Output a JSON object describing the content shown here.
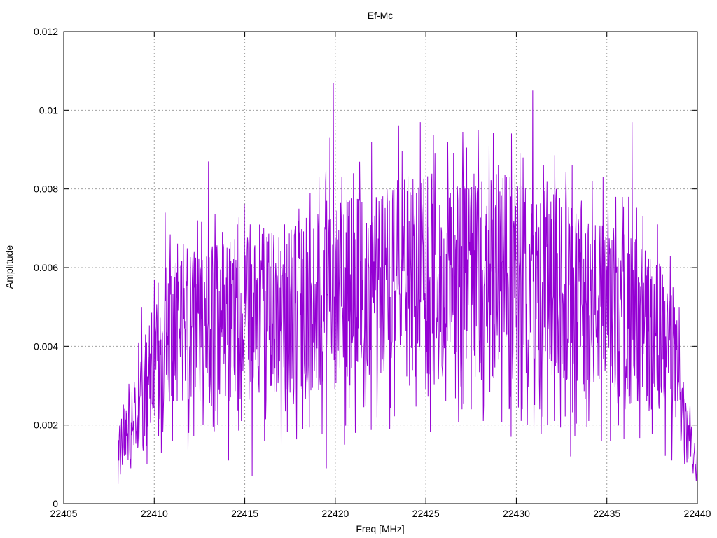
{
  "chart_data": {
    "type": "line",
    "title": "Ef-Mc",
    "xlabel": "Freq [MHz]",
    "ylabel": "Amplitude",
    "xlim": [
      22405,
      22440
    ],
    "ylim": [
      0,
      0.012
    ],
    "xticks": [
      22405,
      22410,
      22415,
      22420,
      22425,
      22430,
      22435,
      22440
    ],
    "xtick_labels": [
      "22405",
      "22410",
      "22415",
      "22420",
      "22425",
      "22430",
      "22435",
      "22440"
    ],
    "yticks": [
      0,
      0.002,
      0.004,
      0.006,
      0.008,
      0.01,
      0.012
    ],
    "ytick_labels": [
      "0",
      "0.002",
      "0.004",
      "0.006",
      "0.008",
      "0.01",
      "0.012"
    ],
    "grid": true,
    "series": [
      {
        "color": "#9400d3",
        "envelope": {
          "x": [
            22408.0,
            22408.5,
            22409.0,
            22409.5,
            22410.0,
            22410.5,
            22411.0,
            22412.0,
            22413.0,
            22414.0,
            22415.0,
            22416.0,
            22417.0,
            22418.0,
            22419.0,
            22420.0,
            22421.0,
            22422.0,
            22423.0,
            22424.0,
            22425.0,
            22426.0,
            22427.0,
            22428.0,
            22429.0,
            22430.0,
            22431.0,
            22432.0,
            22433.0,
            22434.0,
            22435.0,
            22436.0,
            22437.0,
            22438.0,
            22438.8,
            22439.2,
            22439.6,
            22440.0
          ],
          "y": [
            0.0013,
            0.0018,
            0.0024,
            0.003,
            0.0036,
            0.0041,
            0.0043,
            0.0044,
            0.0045,
            0.0046,
            0.0047,
            0.0048,
            0.0049,
            0.005,
            0.0052,
            0.0054,
            0.0055,
            0.0056,
            0.0057,
            0.0058,
            0.0058,
            0.0058,
            0.0058,
            0.0058,
            0.0058,
            0.0057,
            0.0056,
            0.0055,
            0.0053,
            0.0051,
            0.0049,
            0.0048,
            0.0046,
            0.0042,
            0.0035,
            0.0022,
            0.0015,
            0.0009
          ]
        },
        "peaks": {
          "x": [
            22408.0,
            22408.7,
            22409.3,
            22409.6,
            22410.0,
            22410.6,
            22411.0,
            22411.6,
            22412.4,
            22413.0,
            22413.8,
            22414.6,
            22415.3,
            22416.0,
            22417.2,
            22418.0,
            22418.6,
            22419.1,
            22419.7,
            22419.9,
            22420.5,
            22421.0,
            22422.0,
            22423.0,
            22423.5,
            22424.1,
            22424.7,
            22425.5,
            22426.2,
            22427.0,
            22427.9,
            22428.5,
            22429.0,
            22429.7,
            22430.2,
            22430.9,
            22431.5,
            22432.2,
            22433.0,
            22433.6,
            22434.2,
            22434.8,
            22435.5,
            22436.2,
            22436.4,
            22437.0,
            22437.8,
            22438.5,
            22439.0,
            22439.6,
            22440.0
          ],
          "y": [
            0.0005,
            0.0031,
            0.005,
            0.0054,
            0.0057,
            0.0074,
            0.0083,
            0.0066,
            0.0072,
            0.0087,
            0.0066,
            0.0071,
            0.0071,
            0.0066,
            0.0071,
            0.0075,
            0.0079,
            0.0083,
            0.0093,
            0.0107,
            0.0089,
            0.0084,
            0.0092,
            0.0087,
            0.0096,
            0.0087,
            0.0097,
            0.0089,
            0.0092,
            0.0091,
            0.0095,
            0.0091,
            0.0086,
            0.0092,
            0.0089,
            0.0105,
            0.0086,
            0.008,
            0.0082,
            0.0077,
            0.0082,
            0.0083,
            0.0078,
            0.0078,
            0.0097,
            0.0073,
            0.0071,
            0.0063,
            0.005,
            0.0025,
            0.0016
          ]
        },
        "troughs": {
          "x": [
            22408.0,
            22408.7,
            22409.6,
            22410.4,
            22411.0,
            22411.9,
            22412.7,
            22413.5,
            22414.1,
            22414.8,
            22415.4,
            22416.1,
            22417.0,
            22418.2,
            22419.5,
            22420.5,
            22421.1,
            22422.3,
            22423.0,
            22424.1,
            22425.0,
            22426.1,
            22427.0,
            22428.2,
            22429.7,
            22430.6,
            22431.3,
            22432.1,
            22433.0,
            22434.0,
            22434.7,
            22435.2,
            22436.0,
            22437.2,
            22438.6,
            22439.3,
            22440.0
          ],
          "y": [
            0.0005,
            0.0009,
            0.001,
            0.0013,
            0.0016,
            0.0018,
            0.002,
            0.002,
            0.0011,
            0.0021,
            0.0007,
            0.0016,
            0.0015,
            0.0019,
            0.0009,
            0.0015,
            0.0018,
            0.0022,
            0.0019,
            0.003,
            0.0029,
            0.0026,
            0.0024,
            0.0025,
            0.0017,
            0.002,
            0.0024,
            0.0021,
            0.0012,
            0.0021,
            0.0016,
            0.0016,
            0.0024,
            0.0026,
            0.0011,
            0.001,
            0.0005
          ]
        },
        "sample_count": 1500,
        "seed": 20431
      }
    ]
  }
}
